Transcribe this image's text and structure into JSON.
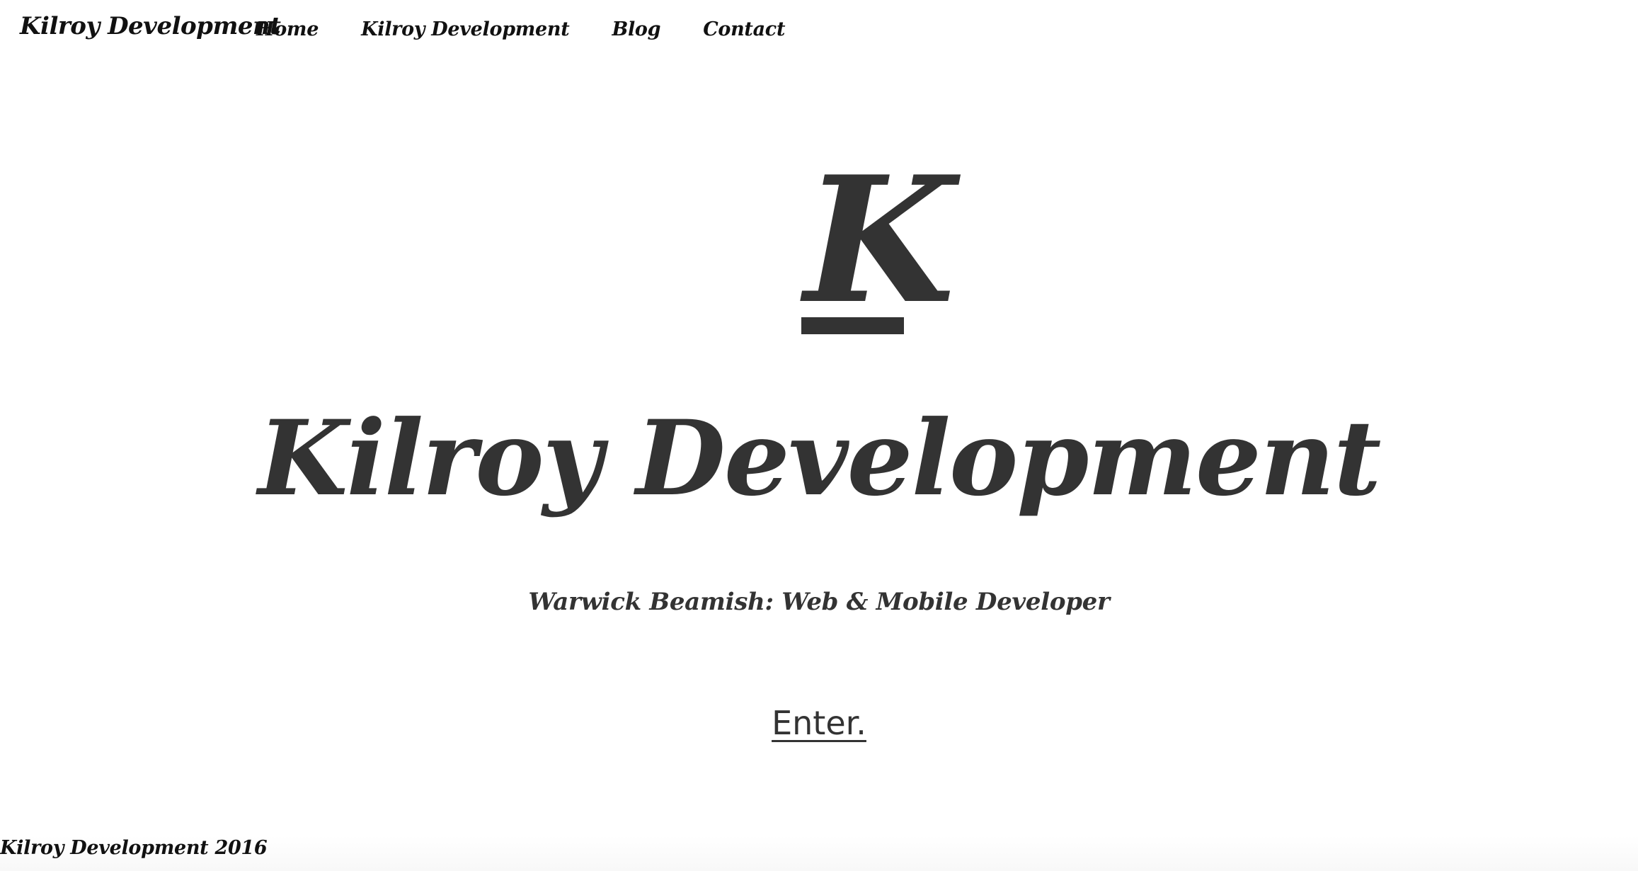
{
  "header": {
    "brand": "Kilroy Development",
    "nav": [
      {
        "label": "Home"
      },
      {
        "label": "Kilroy Development"
      },
      {
        "label": "Blog"
      },
      {
        "label": "Contact"
      }
    ]
  },
  "hero": {
    "logo_letter": "K",
    "title": "Kilroy Development",
    "subtitle": "Warwick Beamish: Web & Mobile Developer",
    "enter_label": "Enter."
  },
  "footer": {
    "text": "Kilroy Development 2016"
  },
  "colors": {
    "text_dark": "#333333",
    "nav_text": "#111111",
    "background": "#ffffff"
  }
}
